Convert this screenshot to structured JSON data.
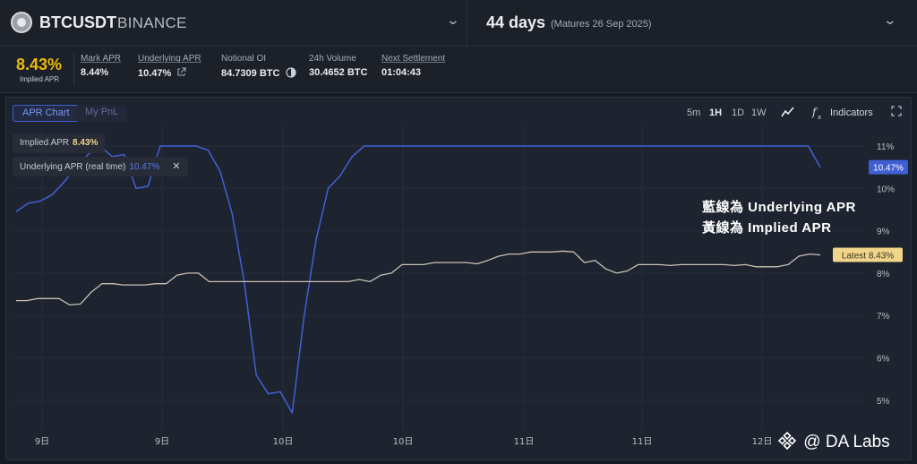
{
  "header": {
    "symbol": "BTCUSDT",
    "exchange": "BINANCE",
    "days": "44 days",
    "matures": "(Matures 26 Sep 2025)"
  },
  "stats": {
    "implied_apr_value": "8.43%",
    "implied_apr_label": "Implied APR",
    "items": [
      {
        "label": "Mark APR",
        "value": "8.44%"
      },
      {
        "label": "Underlying APR",
        "value": "10.47%"
      },
      {
        "label": "Notional OI",
        "value": "84.7309 BTC"
      },
      {
        "label": "24h Volume",
        "value": "30.4652 BTC"
      },
      {
        "label": "Next Settlement",
        "value": "01:04:43"
      }
    ]
  },
  "tabs": [
    "APR Chart",
    "My PnL"
  ],
  "timeframes": [
    "5m",
    "1H",
    "1D",
    "1W"
  ],
  "active_timeframe": "1H",
  "indicators_label": "Indicators",
  "legend": {
    "implied_label": "Implied APR",
    "implied_value": "8.43%",
    "underlying_label": "Underlying APR (real time)",
    "underlying_value": "10.47%",
    "close": "✕"
  },
  "annotation": {
    "line1": "藍線為  Underlying APR",
    "line2": "黃線為  Implied APR"
  },
  "watermark": "@ DA  Labs",
  "colors": {
    "implied": "#c8c2b4",
    "underlying": "#4360d6",
    "accent_yellow": "#f0b90b",
    "latest_tag": "#f0d58a"
  },
  "chart_data": {
    "type": "line",
    "title": "",
    "xlabel": "",
    "ylabel": "",
    "ylim": [
      4.6,
      11.2
    ],
    "x_ticks": [
      "9日",
      "9日",
      "10日",
      "10日",
      "11日",
      "11日",
      "12日"
    ],
    "y_ticks": [
      "11%",
      "10%",
      "9%",
      "8%",
      "7%",
      "6%",
      "5%"
    ],
    "grid": true,
    "price_tags": [
      {
        "series": "Underlying APR",
        "label": "10.47%"
      },
      {
        "series": "Implied APR",
        "label": "Latest  8.43%"
      }
    ],
    "series": [
      {
        "name": "Underlying APR",
        "values": [
          9.45,
          9.65,
          9.7,
          9.85,
          10.15,
          10.5,
          10.8,
          11.0,
          10.75,
          10.8,
          10.0,
          10.05,
          11.0,
          11.0,
          11.0,
          11.0,
          10.9,
          10.4,
          9.4,
          7.8,
          5.6,
          5.15,
          5.2,
          4.7,
          7.0,
          8.8,
          10.0,
          10.3,
          10.75,
          11.0,
          11.0,
          11.0,
          11.0,
          11.0,
          11.0,
          11.0,
          11.0,
          11.0,
          11.0,
          11.0,
          11.0,
          11.0,
          11.0,
          11.0,
          11.0,
          11.0,
          11.0,
          11.0,
          11.0,
          11.0,
          11.0,
          11.0,
          11.0,
          11.0,
          11.0,
          11.0,
          11.0,
          11.0,
          11.0,
          11.0,
          11.0,
          11.0,
          11.0,
          11.0,
          11.0,
          11.0,
          11.0,
          10.5
        ]
      },
      {
        "name": "Implied APR",
        "values": [
          7.35,
          7.35,
          7.4,
          7.4,
          7.4,
          7.25,
          7.27,
          7.55,
          7.75,
          7.75,
          7.72,
          7.72,
          7.72,
          7.75,
          7.75,
          7.95,
          8.0,
          8.0,
          7.8,
          7.8,
          7.8,
          7.8,
          7.8,
          7.8,
          7.8,
          7.8,
          7.8,
          7.8,
          7.8,
          7.8,
          7.8,
          7.8,
          7.85,
          7.8,
          7.95,
          8.0,
          8.2,
          8.2,
          8.2,
          8.25,
          8.25,
          8.25,
          8.25,
          8.22,
          8.3,
          8.4,
          8.45,
          8.45,
          8.5,
          8.5,
          8.5,
          8.52,
          8.5,
          8.25,
          8.3,
          8.1,
          8.0,
          8.05,
          8.2,
          8.2,
          8.2,
          8.18,
          8.2,
          8.2,
          8.2,
          8.2,
          8.2,
          8.18,
          8.2,
          8.15,
          8.15,
          8.15,
          8.2,
          8.4,
          8.45,
          8.43
        ]
      }
    ]
  }
}
